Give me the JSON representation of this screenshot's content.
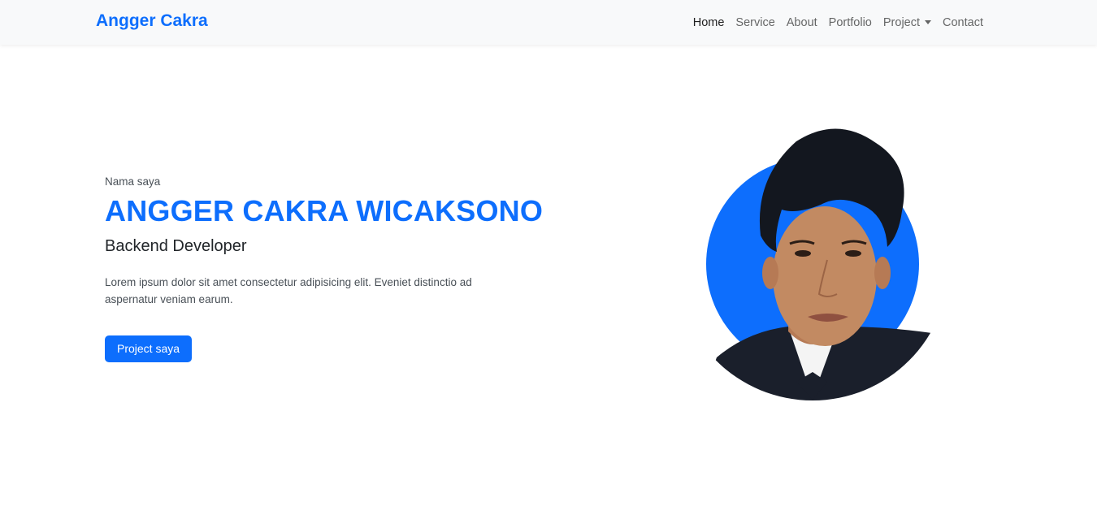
{
  "navbar": {
    "brand": "Angger Cakra",
    "links": [
      {
        "label": "Home"
      },
      {
        "label": "Service"
      },
      {
        "label": "About"
      },
      {
        "label": "Portfolio"
      },
      {
        "label": "Project"
      },
      {
        "label": "Contact"
      }
    ]
  },
  "hero": {
    "eyebrow": "Nama saya",
    "name": "ANGGER CAKRA WICAKSONO",
    "role": "Backend Developer",
    "description": "Lorem ipsum dolor sit amet consectetur adipisicing elit. Eveniet distinctio ad aspernatur veniam earum.",
    "cta_label": "Project saya"
  },
  "colors": {
    "primary": "#0d6efd",
    "navbar_bg": "#f8f9fa"
  },
  "icons": {
    "dropdown": "caret-down-icon"
  }
}
